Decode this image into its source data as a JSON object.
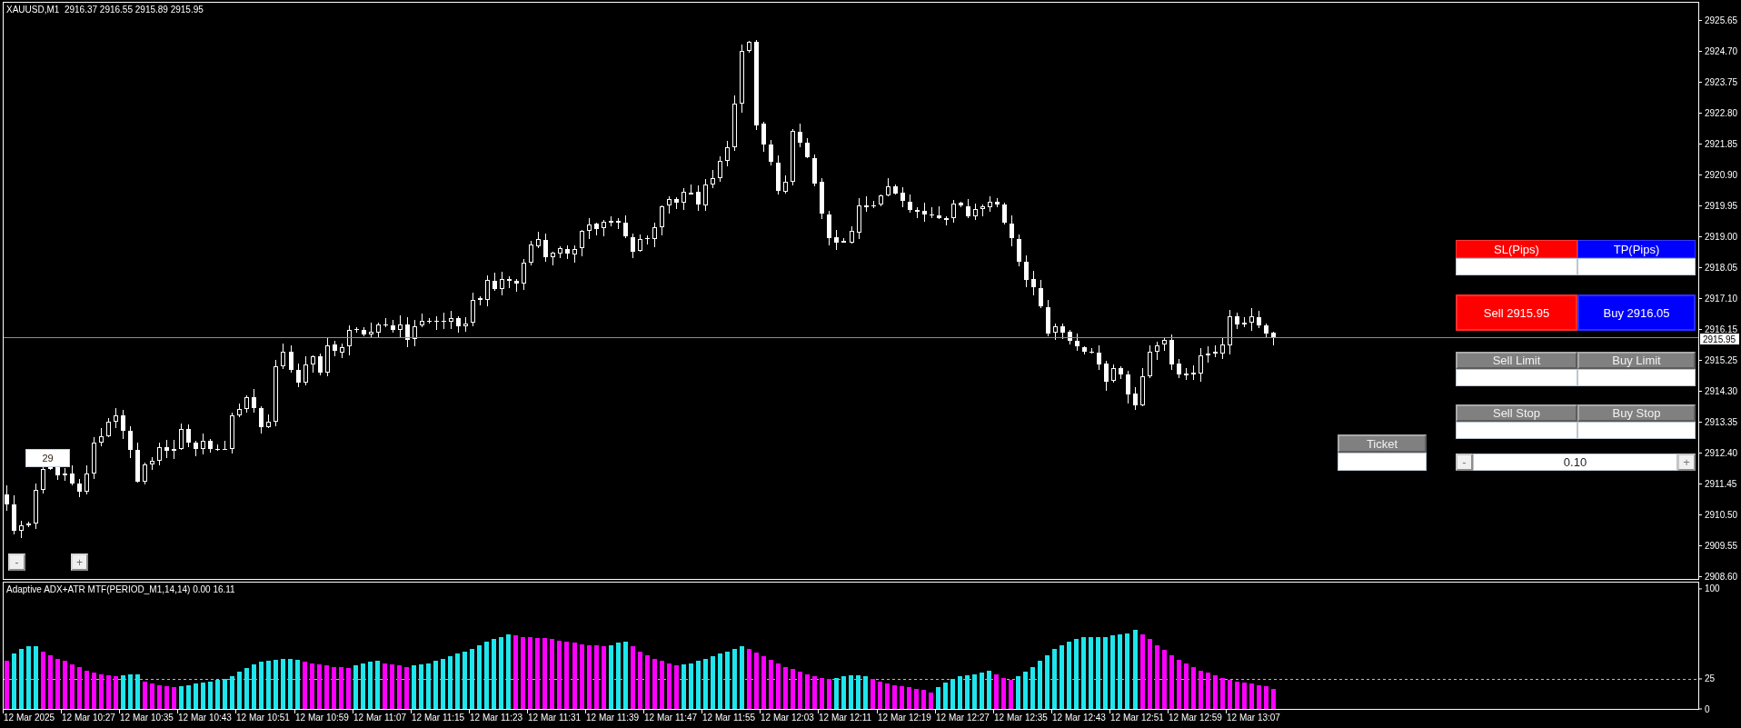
{
  "chart": {
    "title": "XAUUSD,M1  2916.37 2916.55 2915.89 2915.95",
    "price_axis_labels": [
      "2925.65",
      "2924.70",
      "2923.75",
      "2922.80",
      "2921.85",
      "2920.90",
      "2919.95",
      "2919.00",
      "2918.05",
      "2917.10",
      "2916.15",
      "2915.25",
      "2914.30",
      "2913.35",
      "2912.40",
      "2911.45",
      "2910.50",
      "2909.55",
      "2908.60"
    ],
    "bid_price_label": "2915.95",
    "count_label": "29",
    "chart_buttons": [
      "-",
      "+"
    ]
  },
  "trade_panel": {
    "risk_fields": [
      {
        "label": "SL(Pips)",
        "color": "#ff0000"
      },
      {
        "label": "TP(Pips)",
        "color": "#0000ff"
      }
    ],
    "market_buttons": [
      {
        "label": "Sell 2915.95",
        "color": "#ff0000"
      },
      {
        "label": "Buy 2916.05",
        "color": "#0000ff"
      }
    ],
    "pending_rows": [
      [
        "Sell Limit",
        "Buy Limit"
      ],
      [
        "Sell Stop",
        "Buy Stop"
      ]
    ],
    "lot": {
      "decrease": "-",
      "value": "0.10",
      "increase": "+"
    },
    "ticket": {
      "label": "Ticket"
    }
  },
  "indicator": {
    "title": "Adaptive ADX+ATR MTF(PERIOD_M1,14,14) 0.00 16.11",
    "chart_data": {
      "type": "bar",
      "stacked": true,
      "ylim": [
        0,
        106
      ],
      "yticks": [
        0,
        25,
        100
      ],
      "series": [
        {
          "color": "#1ee6ec",
          "values": [
            null,
            46,
            50,
            52,
            52,
            null,
            null,
            null,
            null,
            null,
            null,
            null,
            null,
            null,
            null,
            null,
            28,
            29,
            29,
            null,
            null,
            null,
            null,
            null,
            19,
            20,
            21,
            22,
            23,
            24,
            25,
            27,
            31,
            34,
            37,
            39,
            40,
            41,
            42,
            42,
            41,
            null,
            null,
            null,
            null,
            null,
            null,
            null,
            36,
            38,
            39,
            40,
            null,
            null,
            null,
            null,
            36,
            37,
            38,
            40,
            42,
            44,
            46,
            48,
            50,
            53,
            56,
            58,
            60,
            62,
            null,
            null,
            null,
            null,
            null,
            null,
            null,
            null,
            null,
            null,
            null,
            null,
            null,
            53,
            55,
            56,
            null,
            null,
            null,
            null,
            null,
            null,
            null,
            37,
            38,
            40,
            42,
            44,
            46,
            48,
            50,
            52,
            null,
            null,
            null,
            null,
            null,
            null,
            null,
            null,
            null,
            null,
            null,
            null,
            26,
            27,
            28,
            28,
            27,
            null,
            null,
            null,
            null,
            null,
            null,
            null,
            null,
            null,
            18,
            22,
            25,
            27,
            28,
            29,
            30,
            32,
            null,
            null,
            null,
            27,
            31,
            35,
            40,
            45,
            50,
            53,
            56,
            58,
            60,
            60,
            60,
            60,
            61,
            62,
            63,
            66,
            null,
            null,
            null,
            null,
            null,
            null,
            null,
            null,
            null,
            null,
            null,
            null,
            null,
            null,
            null,
            null,
            null,
            null,
            null,
            null,
            null,
            null,
            null,
            null,
            null,
            null,
            null,
            null,
            null,
            null,
            null,
            null,
            null,
            null,
            null,
            null,
            null,
            null,
            null,
            null,
            null,
            null,
            null,
            null,
            null,
            null,
            null,
            null,
            null,
            null,
            null,
            null,
            null,
            null,
            null,
            null,
            null,
            null,
            null,
            null,
            null,
            null,
            null,
            null,
            null,
            null,
            null
          ]
        },
        {
          "color": "#ff00ff",
          "values": [
            40,
            null,
            null,
            null,
            null,
            48,
            45,
            42,
            40,
            37,
            35,
            32,
            30,
            29,
            28,
            27,
            null,
            null,
            null,
            23,
            21,
            20,
            19,
            18,
            null,
            null,
            null,
            null,
            null,
            null,
            null,
            null,
            null,
            null,
            null,
            null,
            null,
            null,
            null,
            null,
            null,
            39,
            38,
            37,
            36,
            35,
            35,
            34,
            null,
            null,
            null,
            null,
            38,
            37,
            36,
            35,
            null,
            null,
            null,
            null,
            null,
            null,
            null,
            null,
            null,
            null,
            null,
            null,
            null,
            null,
            61,
            60,
            60,
            59,
            59,
            58,
            57,
            56,
            55,
            54,
            53,
            53,
            52,
            null,
            null,
            null,
            52,
            48,
            45,
            42,
            40,
            38,
            36,
            null,
            null,
            null,
            null,
            null,
            null,
            null,
            null,
            null,
            50,
            47,
            44,
            41,
            38,
            35,
            33,
            31,
            29,
            27,
            26,
            25,
            null,
            null,
            null,
            null,
            null,
            25,
            23,
            21,
            20,
            19,
            18,
            17,
            16,
            14,
            null,
            null,
            null,
            null,
            null,
            null,
            null,
            null,
            29,
            26,
            24,
            null,
            null,
            null,
            null,
            null,
            null,
            null,
            null,
            null,
            null,
            null,
            null,
            null,
            null,
            null,
            null,
            null,
            62,
            58,
            53,
            49,
            45,
            41,
            38,
            35,
            32,
            30,
            28,
            26,
            24,
            23,
            22,
            21,
            20,
            19,
            17,
            null,
            null,
            null,
            null,
            null,
            null,
            null,
            null,
            null,
            null,
            null,
            null,
            null,
            null,
            null,
            null,
            null,
            null,
            null,
            null,
            null,
            null,
            null,
            null,
            null,
            null,
            null,
            null,
            null,
            null,
            null,
            null,
            null,
            null,
            null,
            null,
            null,
            null,
            null,
            null,
            null,
            null,
            null,
            null,
            null,
            null,
            null,
            null,
            null,
            null,
            null,
            null,
            null,
            null,
            null,
            null,
            null,
            null
          ]
        }
      ]
    },
    "time_axis_labels": [
      "12 Mar 2025",
      "12 Mar 10:27",
      "12 Mar 10:35",
      "12 Mar 10:43",
      "12 Mar 10:51",
      "12 Mar 10:59",
      "12 Mar 11:07",
      "12 Mar 11:15",
      "12 Mar 11:23",
      "12 Mar 11:31",
      "12 Mar 11:39",
      "12 Mar 11:47",
      "12 Mar 11:55",
      "12 Mar 12:03",
      "12 Mar 12:11",
      "12 Mar 12:19",
      "12 Mar 12:27",
      "12 Mar 12:35",
      "12 Mar 12:43",
      "12 Mar 12:51",
      "12 Mar 12:59",
      "12 Mar 13:07"
    ]
  }
}
